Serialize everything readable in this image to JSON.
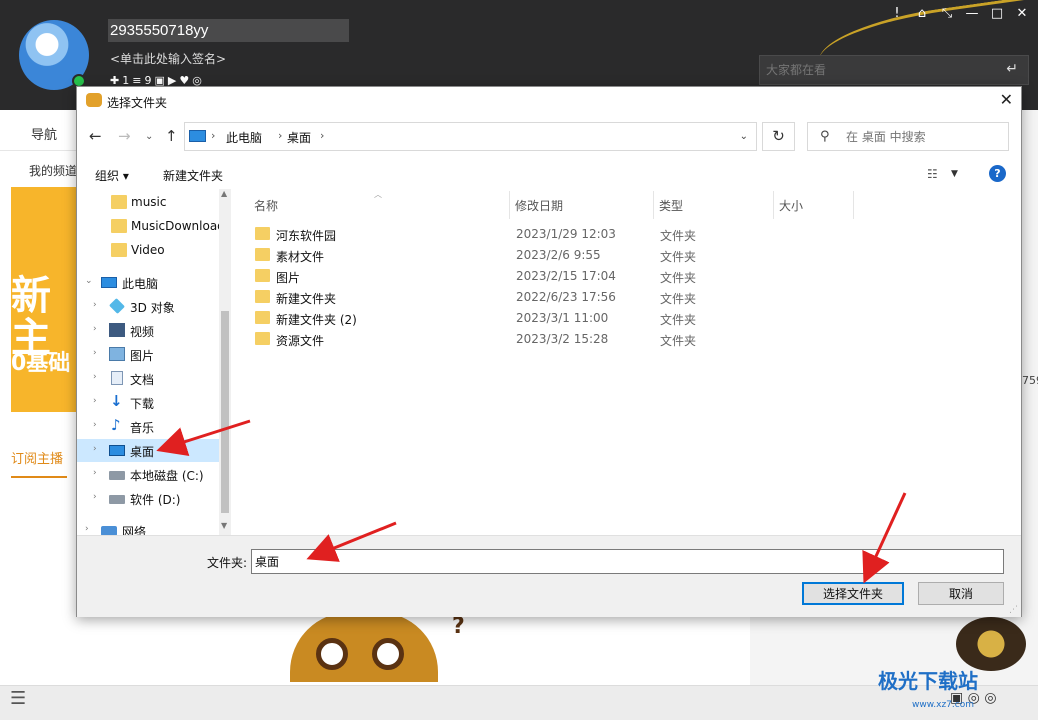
{
  "app": {
    "username": "2935550718yy",
    "signature": "<单击此处输入签名>",
    "badge_counts": [
      "1",
      "9"
    ],
    "watching_placeholder": "大家都在看",
    "nav_label": "导航",
    "channel_label": "我的频道",
    "banner_text_big": "新主",
    "banner_text_small": "0基础",
    "subscribe_label": "订阅主播",
    "right_number": "759",
    "watermark_text": "极光下载站",
    "watermark_url": "www.xz7.com"
  },
  "dialog": {
    "title": "选择文件夹",
    "address": {
      "segments": [
        "此电脑",
        "桌面"
      ]
    },
    "search_placeholder": "在 桌面 中搜索",
    "toolbar": {
      "organize": "组织 ▾",
      "new_folder": "新建文件夹"
    },
    "tree": [
      {
        "label": "music",
        "icon": "folder-icon"
      },
      {
        "label": "MusicDownload",
        "icon": "folder-icon"
      },
      {
        "label": "Video",
        "icon": "folder-icon"
      },
      {
        "label": "此电脑",
        "icon": "computer-icon"
      },
      {
        "label": "3D 对象",
        "icon": "3d-objects-icon"
      },
      {
        "label": "视频",
        "icon": "video-icon"
      },
      {
        "label": "图片",
        "icon": "pictures-icon"
      },
      {
        "label": "文档",
        "icon": "documents-icon"
      },
      {
        "label": "下载",
        "icon": "download-icon"
      },
      {
        "label": "音乐",
        "icon": "music-icon"
      },
      {
        "label": "桌面",
        "icon": "desktop-icon"
      },
      {
        "label": "本地磁盘 (C:)",
        "icon": "drive-icon"
      },
      {
        "label": "软件 (D:)",
        "icon": "drive-icon"
      },
      {
        "label": "网络",
        "icon": "network-icon"
      }
    ],
    "columns": {
      "name": "名称",
      "modified": "修改日期",
      "type": "类型",
      "size": "大小"
    },
    "files": [
      {
        "name": "河东软件园",
        "date": "2023/1/29 12:03",
        "type": "文件夹"
      },
      {
        "name": "素材文件",
        "date": "2023/2/6 9:55",
        "type": "文件夹"
      },
      {
        "name": "图片",
        "date": "2023/2/15 17:04",
        "type": "文件夹"
      },
      {
        "name": "新建文件夹",
        "date": "2022/6/23 17:56",
        "type": "文件夹"
      },
      {
        "name": "新建文件夹 (2)",
        "date": "2023/3/1 11:00",
        "type": "文件夹"
      },
      {
        "name": "资源文件",
        "date": "2023/3/2 15:28",
        "type": "文件夹"
      }
    ],
    "folder_field_label": "文件夹:",
    "folder_field_value": "桌面",
    "select_button": "选择文件夹",
    "cancel_button": "取消"
  },
  "colors": {
    "accent": "#0078d7",
    "selection": "#cce8ff",
    "folder": "#f5cf63",
    "annotation": "#e02020",
    "app_header": "#2a2a2b"
  }
}
